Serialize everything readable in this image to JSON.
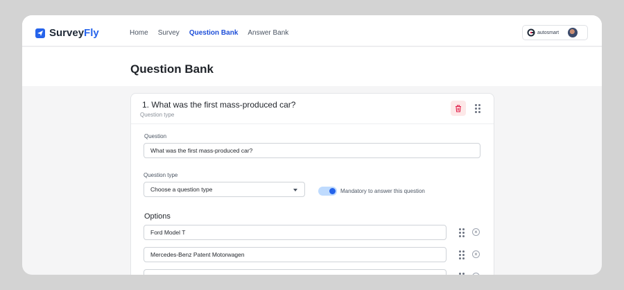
{
  "app": {
    "logo_prefix": "Survey",
    "logo_suffix": "Fly"
  },
  "nav": {
    "items": [
      "Home",
      "Survey",
      "Question Bank",
      "Answer Bank"
    ],
    "active": "Question Bank"
  },
  "account": {
    "brand": "autosmart"
  },
  "page": {
    "title": "Question Bank"
  },
  "question": {
    "title": "1. What was the first mass-produced car?",
    "subtitle": "Question type",
    "question_label": "Question",
    "question_value": "What was the first mass-produced car?",
    "type_label": "Question type",
    "type_value": "Choose a question type",
    "mandatory_label": "Mandatory to answer this question",
    "mandatory_on": true
  },
  "options": {
    "title": "Options",
    "items": [
      "Ford Model T",
      "Mercedes-Benz Patent Motorwagen"
    ]
  },
  "colors": {
    "accent": "#2563eb",
    "danger": "#e11d48"
  }
}
